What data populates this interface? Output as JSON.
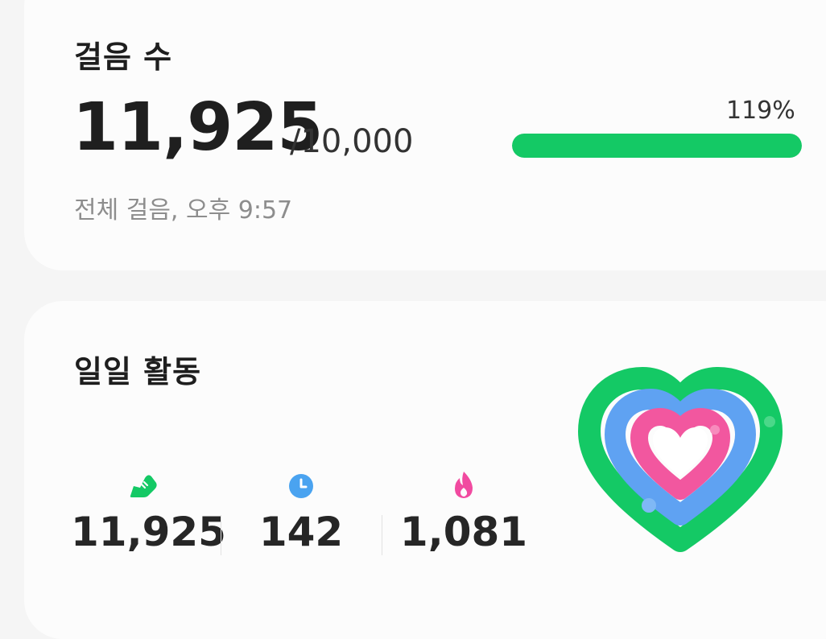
{
  "steps_card": {
    "title": "걸음 수",
    "count": "11,925",
    "goal": "/10,000",
    "percent": "119%",
    "progress_fraction": 1.0,
    "subtitle": "전체 걸음, 오후 9:57"
  },
  "activity_card": {
    "title": "일일 활동",
    "stats": [
      {
        "icon": "shoe-icon",
        "value": "11,925",
        "color": "#14c965"
      },
      {
        "icon": "clock-icon",
        "value": "142",
        "color": "#4aa3f0"
      },
      {
        "icon": "flame-icon",
        "value": "1,081",
        "color": "#f14aa0"
      }
    ],
    "rings": {
      "steps_color": "#14c965",
      "minutes_color": "#5fa2f2",
      "calories_color": "#f2579f"
    }
  },
  "colors": {
    "accent_green": "#14c965",
    "accent_blue": "#4aa3f0",
    "accent_pink": "#f14aa0"
  }
}
